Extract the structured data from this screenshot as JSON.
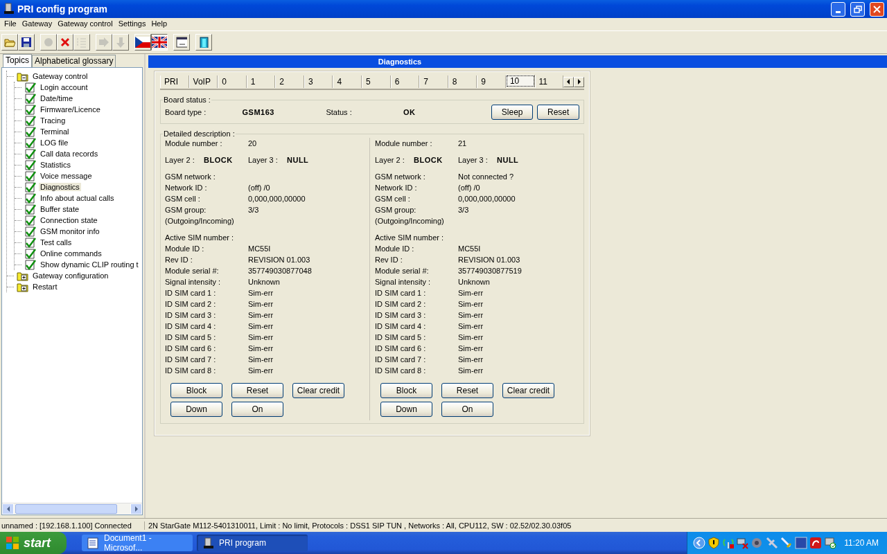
{
  "window": {
    "title": "PRI config program"
  },
  "menu": [
    "File",
    "Gateway",
    "Gateway control",
    "Settings",
    "Help"
  ],
  "toolbar": {
    "tools": [
      [
        {
          "kind": "open",
          "disabled": false
        },
        {
          "kind": "save",
          "disabled": false
        }
      ],
      [
        {
          "kind": "record",
          "disabled": true
        },
        {
          "kind": "delete",
          "disabled": false
        },
        {
          "kind": "list",
          "disabled": true
        }
      ],
      [
        {
          "kind": "forward",
          "disabled": true
        },
        {
          "kind": "back",
          "disabled": true
        }
      ]
    ],
    "languages": [
      {
        "kind": "cz",
        "selected": false
      },
      {
        "kind": "uk",
        "selected": true
      }
    ],
    "extras": [
      [
        {
          "kind": "terminal",
          "disabled": false
        }
      ],
      [
        {
          "kind": "exit",
          "disabled": false
        }
      ]
    ]
  },
  "sidebar": {
    "tabs": [
      {
        "label": "Topics",
        "selected": true
      },
      {
        "label": "Alphabetical glossary",
        "selected": false
      }
    ],
    "tree": [
      {
        "label": "Gateway control",
        "expanded": true,
        "children": [
          {
            "label": "Login account",
            "selected": false
          },
          {
            "label": "Date/time",
            "selected": false
          },
          {
            "label": "Firmware/Licence",
            "selected": false
          },
          {
            "label": "Tracing",
            "selected": false
          },
          {
            "label": "Terminal",
            "selected": false
          },
          {
            "label": "LOG file",
            "selected": false
          },
          {
            "label": "Call data records",
            "selected": false
          },
          {
            "label": "Statistics",
            "selected": false
          },
          {
            "label": "Voice message",
            "selected": false
          },
          {
            "label": "Diagnostics",
            "selected": true
          },
          {
            "label": "Info about actual calls",
            "selected": false
          },
          {
            "label": "Buffer state",
            "selected": false
          },
          {
            "label": "Connection state",
            "selected": false
          },
          {
            "label": "GSM monitor info",
            "selected": false
          },
          {
            "label": "Test calls",
            "selected": false
          },
          {
            "label": "Online commands",
            "selected": false
          },
          {
            "label": "Show dynamic CLIP routing t",
            "selected": false
          }
        ]
      },
      {
        "label": "Gateway configuration",
        "expanded": false
      },
      {
        "label": "Restart",
        "expanded": false
      }
    ]
  },
  "panel": {
    "title": "Diagnostics",
    "tabs": [
      {
        "label": "PRI",
        "selected": false
      },
      {
        "label": "VoIP",
        "selected": false
      },
      {
        "label": "0",
        "selected": false
      },
      {
        "label": "1",
        "selected": false
      },
      {
        "label": "2",
        "selected": false
      },
      {
        "label": "3",
        "selected": false
      },
      {
        "label": "4",
        "selected": false
      },
      {
        "label": "5",
        "selected": false
      },
      {
        "label": "6",
        "selected": false
      },
      {
        "label": "7",
        "selected": false
      },
      {
        "label": "8",
        "selected": false
      },
      {
        "label": "9",
        "selected": false
      },
      {
        "label": "10",
        "selected": true
      },
      {
        "label": "11",
        "selected": false
      }
    ],
    "board_status": {
      "legend": "Board status :",
      "fields": [
        {
          "label": "Board type :",
          "value": "GSM163"
        },
        {
          "label": "Status :",
          "value": "OK"
        }
      ],
      "buttons": [
        "Sleep",
        "Reset"
      ]
    },
    "details": {
      "legend": "Detailed description :",
      "modules": [
        {
          "number": {
            "label": "Module number :",
            "value": "20"
          },
          "layers": [
            {
              "label": "Layer 2 :",
              "value": "BLOCK"
            },
            {
              "label": "Layer 3 :",
              "value": "NULL"
            }
          ],
          "groups": [
            [
              {
                "label": "GSM network :"
              },
              {
                "label": "Network ID :",
                "value": "(off)  /0"
              },
              {
                "label": "GSM cell :",
                "value": "0,000,000,00000"
              },
              {
                "label": "GSM group:",
                "value": "3/3"
              },
              {
                "label": "(Outgoing/Incoming)"
              }
            ],
            [
              {
                "label": "Active SIM number :"
              },
              {
                "label": "Module ID :",
                "value": "MC55I"
              },
              {
                "label": "Rev ID :",
                "value": "REVISION 01.003"
              },
              {
                "label": "Module serial #:",
                "value": "357749030877048"
              },
              {
                "label": "Signal intensity :",
                "value": "Unknown"
              },
              {
                "label": "ID SIM card 1 :",
                "value": "Sim-err"
              },
              {
                "label": "ID SIM card 2 :",
                "value": "Sim-err"
              },
              {
                "label": "ID SIM card 3 :",
                "value": "Sim-err"
              },
              {
                "label": "ID SIM card 4 :",
                "value": "Sim-err"
              },
              {
                "label": "ID SIM card 5 :",
                "value": "Sim-err"
              },
              {
                "label": "ID SIM card 6 :",
                "value": "Sim-err"
              },
              {
                "label": "ID SIM card 7 :",
                "value": "Sim-err"
              },
              {
                "label": "ID SIM card 8 :",
                "value": "Sim-err"
              }
            ]
          ],
          "buttons": [
            [
              "Block",
              "Reset",
              "Clear credit"
            ],
            [
              "Down",
              "On"
            ]
          ]
        },
        {
          "number": {
            "label": "Module number :",
            "value": "21"
          },
          "layers": [
            {
              "label": "Layer 2 :",
              "value": "BLOCK"
            },
            {
              "label": "Layer 3 :",
              "value": "NULL"
            }
          ],
          "groups": [
            [
              {
                "label": "GSM network :",
                "value": "Not connected ?"
              },
              {
                "label": "Network ID :",
                "value": "(off)  /0"
              },
              {
                "label": "GSM cell :",
                "value": "0,000,000,00000"
              },
              {
                "label": "GSM group:",
                "value": "3/3"
              },
              {
                "label": "(Outgoing/Incoming)"
              }
            ],
            [
              {
                "label": "Active SIM number :"
              },
              {
                "label": "Module ID :",
                "value": "MC55I"
              },
              {
                "label": "Rev ID :",
                "value": "REVISION 01.003"
              },
              {
                "label": "Module serial #:",
                "value": "357749030877519"
              },
              {
                "label": "Signal intensity :",
                "value": "Unknown"
              },
              {
                "label": "ID SIM card 1 :",
                "value": "Sim-err"
              },
              {
                "label": "ID SIM card 2 :",
                "value": "Sim-err"
              },
              {
                "label": "ID SIM card 3 :",
                "value": "Sim-err"
              },
              {
                "label": "ID SIM card 4 :",
                "value": "Sim-err"
              },
              {
                "label": "ID SIM card 5 :",
                "value": "Sim-err"
              },
              {
                "label": "ID SIM card 6 :",
                "value": "Sim-err"
              },
              {
                "label": "ID SIM card 7 :",
                "value": "Sim-err"
              },
              {
                "label": "ID SIM card 8 :",
                "value": "Sim-err"
              }
            ]
          ],
          "buttons": [
            [
              "Block",
              "Reset",
              "Clear credit"
            ],
            [
              "Down",
              "On"
            ]
          ]
        }
      ]
    }
  },
  "status_bar": [
    "unnamed : [192.168.1.100] Connected",
    "2N StarGate M112-5401310011, Limit : No limit, Protocols : DSS1 SIP TUN , Networks : All, CPU112, SW : 02.52/02.30.03f05"
  ],
  "taskbar": {
    "start": "start",
    "tasks": [
      {
        "kind": "document",
        "label": "Document1 - Microsof...",
        "selected": false
      },
      {
        "kind": "program",
        "label": "PRI program",
        "selected": true
      }
    ],
    "clock": "11:20 AM"
  }
}
